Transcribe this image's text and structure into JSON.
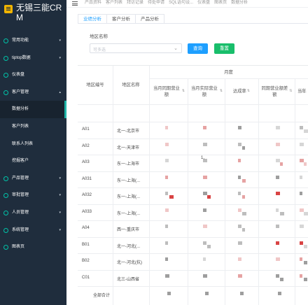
{
  "app": {
    "title": "无锡三能CRM"
  },
  "colors": {
    "sidebar_bg": "#1f2d3d",
    "accent": "#1e9fff",
    "success": "#19be6b",
    "teal": "#1fb5a8"
  },
  "sidebar": {
    "items": [
      {
        "label": "常用功能",
        "icon": "circle-icon",
        "arrow": "▾",
        "sub": false
      },
      {
        "label": "tiptop数据",
        "icon": "circle-icon",
        "arrow": "▾",
        "sub": false
      },
      {
        "label": "仪表盘",
        "icon": "circle-icon",
        "arrow": "",
        "sub": false
      },
      {
        "label": "客户管理",
        "icon": "circle-icon",
        "arrow": "▴",
        "sub": false
      },
      {
        "label": "数据分析",
        "icon": "",
        "arrow": "",
        "sub": true,
        "active": true
      },
      {
        "label": "客户列表",
        "icon": "",
        "arrow": "",
        "sub": true
      },
      {
        "label": "联系人列表",
        "icon": "",
        "arrow": "",
        "sub": true
      },
      {
        "label": "挖掘客户",
        "icon": "",
        "arrow": "",
        "sub": true
      },
      {
        "label": "产品管理",
        "icon": "circle-icon",
        "arrow": "▾",
        "sub": false
      },
      {
        "label": "审批管理",
        "icon": "circle-icon",
        "arrow": "▾",
        "sub": false
      },
      {
        "label": "人员管理",
        "icon": "circle-icon",
        "arrow": "▾",
        "sub": false
      },
      {
        "label": "系统管理",
        "icon": "circle-icon",
        "arrow": "▾",
        "sub": false
      },
      {
        "label": "图表页",
        "icon": "circle-icon",
        "arrow": "",
        "sub": false
      }
    ]
  },
  "topbar": {
    "links": [
      "产品资料",
      "客户列表",
      "拜访记录",
      "待处申请",
      "SQL语句设...",
      "仪表盘",
      "图表页",
      "数据分析"
    ]
  },
  "tabs": [
    {
      "label": "业绩分析",
      "active": true
    },
    {
      "label": "客户分析",
      "active": false
    },
    {
      "label": "产品分析",
      "active": false
    }
  ],
  "filter": {
    "label": "地区名称",
    "placeholder": "可多选",
    "query_label": "查询",
    "reset_label": "重置"
  },
  "table": {
    "group_header": "月度",
    "headers": {
      "code": "地区编号",
      "name": "地区名称",
      "col1": "当月同期营业额",
      "col2": "当月实际营业额",
      "col3": "达成率",
      "col4": "同期营业额差额",
      "col5": "当年"
    },
    "rows": [
      {
        "code": "A01",
        "name": "北一-北京市"
      },
      {
        "code": "A02",
        "name": "北一-天津市"
      },
      {
        "code": "A03",
        "name": "东一-上海市"
      },
      {
        "code": "A031",
        "name": "东一-上海(..."
      },
      {
        "code": "A032",
        "name": "东一-上海(..."
      },
      {
        "code": "A033",
        "name": "东一-上海(..."
      },
      {
        "code": "A04",
        "name": "西一-重庆市"
      },
      {
        "code": "B01",
        "name": "北一-河北(..."
      },
      {
        "code": "B02",
        "name": "北一-河北(抗)"
      },
      {
        "code": "C01",
        "name": "北三-山西省"
      }
    ],
    "total_label": "全部合计",
    "partial_value": "1,"
  }
}
